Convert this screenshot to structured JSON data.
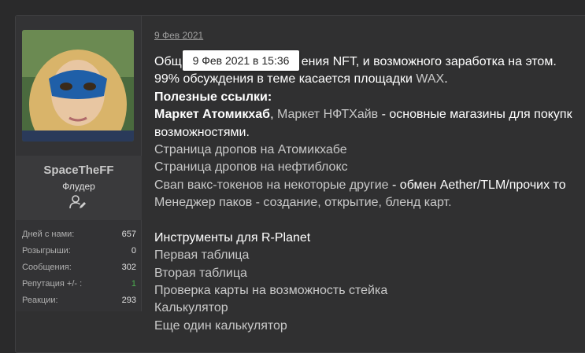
{
  "user": {
    "name": "SpaceTheFF",
    "title": "Флудер",
    "stats": [
      {
        "label": "Дней с нами:",
        "value": "657",
        "highlight": false
      },
      {
        "label": "Розыгрыши:",
        "value": "0",
        "highlight": false
      },
      {
        "label": "Сообщения:",
        "value": "302",
        "highlight": false
      },
      {
        "label": "Репутация +/- :",
        "value": "1",
        "highlight": true
      },
      {
        "label": "Реакции:",
        "value": "293",
        "highlight": false
      }
    ]
  },
  "post": {
    "date": "9 Фев 2021",
    "tooltip": "9 Фев 2021 в 15:36",
    "lines": {
      "l1a": "Общ",
      "l1b": "ения NFT, и возможного заработка на этом.",
      "l2a": "99% обсуждения в теме касается площадки ",
      "l2b": "WAX",
      "l2c": ".",
      "l3": "Полезные ссылки:",
      "l4a": "Маркет Атомикхаб",
      "l4b": ", ",
      "l4c": "Маркет НФТХайв",
      "l4d": " - основные магазины для покупк",
      "l5": "возможностями.",
      "l6": "Страница дропов на Атомикхабе",
      "l7": "Страница дропов на нефтиблокс",
      "l8a": "Свап вакс-токенов на некоторые другие",
      "l8b": " - обмен Aether/TLM/прочих то",
      "l9": "Менеджер паков - создание, открытие, бленд карт.",
      "l10": "Инструменты для R-Planet",
      "l11": "Первая таблица",
      "l12": "Вторая таблица",
      "l13": "Проверка карты на возможность стейка",
      "l14": "Калькулятор",
      "l15": "Еще один калькулятор"
    }
  }
}
